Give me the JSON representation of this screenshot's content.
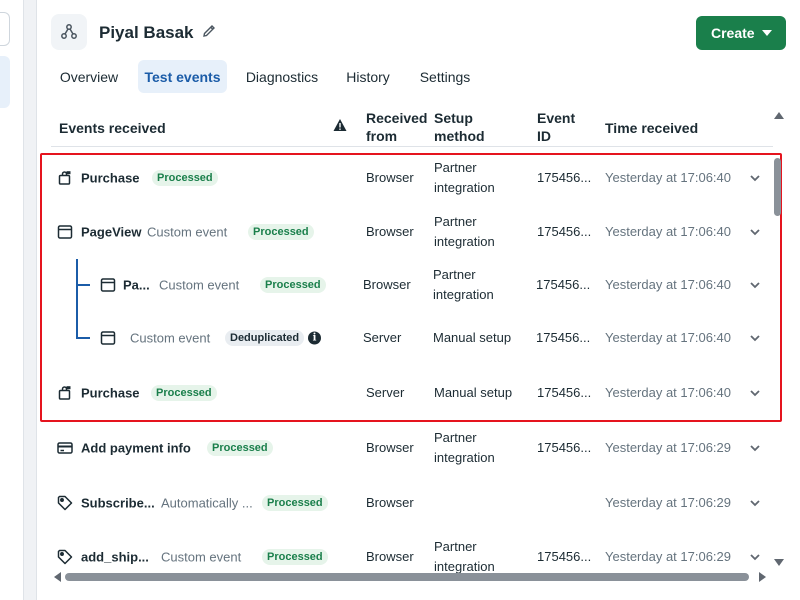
{
  "header": {
    "title": "Piyal Basak",
    "create_label": "Create",
    "icon": "dataset-icon"
  },
  "tabs": [
    {
      "label": "Overview",
      "active": false
    },
    {
      "label": "Test events",
      "active": true
    },
    {
      "label": "Diagnostics",
      "active": false
    },
    {
      "label": "History",
      "active": false
    },
    {
      "label": "Settings",
      "active": false
    }
  ],
  "table": {
    "columns": {
      "events": "Events received",
      "received_from": [
        "Received",
        "from"
      ],
      "setup_method": [
        "Setup",
        "method"
      ],
      "event_id": [
        "Event",
        "ID"
      ],
      "time": "Time received"
    },
    "rows": [
      {
        "icon": "purchase-bag-icon",
        "name": "Purchase",
        "type": "",
        "status": "Processed",
        "received_from": "Browser",
        "setup": [
          "Partner",
          "integration"
        ],
        "event_id": "175456...",
        "time": "Yesterday at 17:06:40"
      },
      {
        "icon": "page-icon",
        "name": "PageView",
        "type": "Custom event",
        "status": "Processed",
        "received_from": "Browser",
        "setup": [
          "Partner",
          "integration"
        ],
        "event_id": "175456...",
        "time": "Yesterday at 17:06:40"
      },
      {
        "icon": "page-icon",
        "name": "Pa...",
        "type": "Custom event",
        "status": "Processed",
        "received_from": "Browser",
        "setup": [
          "Partner",
          "integration"
        ],
        "event_id": "175456...",
        "time": "Yesterday at 17:06:40"
      },
      {
        "icon": "page-icon",
        "name": "",
        "type": "Custom event",
        "status": "Deduplicated",
        "received_from": "Server",
        "setup": [
          "Manual setup"
        ],
        "event_id": "175456...",
        "time": "Yesterday at 17:06:40"
      },
      {
        "icon": "purchase-bag-icon",
        "name": "Purchase",
        "type": "",
        "status": "Processed",
        "received_from": "Server",
        "setup": [
          "Manual setup"
        ],
        "event_id": "175456...",
        "time": "Yesterday at 17:06:40"
      },
      {
        "icon": "credit-card-icon",
        "name": "Add payment info",
        "type": "",
        "status": "Processed",
        "received_from": "Browser",
        "setup": [
          "Partner",
          "integration"
        ],
        "event_id": "175456...",
        "time": "Yesterday at 17:06:29"
      },
      {
        "icon": "tag-icon",
        "name": "Subscribe...",
        "type": "Automatically ...",
        "status": "Processed",
        "received_from": "Browser",
        "setup": [
          ""
        ],
        "event_id": "",
        "time": "Yesterday at 17:06:29"
      },
      {
        "icon": "tag-icon",
        "name": "add_ship...",
        "type": "Custom event",
        "status": "Processed",
        "received_from": "Browser",
        "setup": [
          "Partner",
          "integration"
        ],
        "event_id": "175456...",
        "time": "Yesterday at 17:06:29"
      }
    ]
  },
  "colors": {
    "accent": "#1b5ca8",
    "create_button": "#1a7f4b",
    "processed_badge": "#e6f4ea",
    "highlight_border": "#e5141e"
  }
}
